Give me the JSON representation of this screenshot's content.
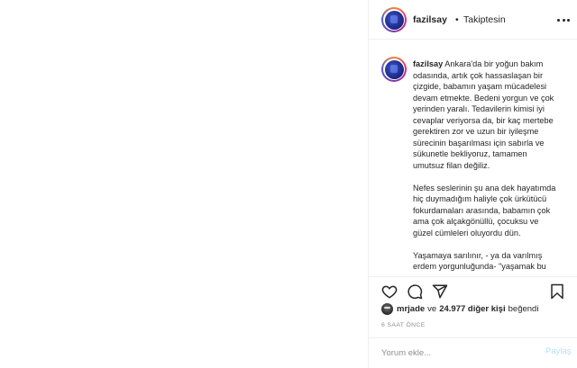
{
  "header": {
    "username": "fazilsay",
    "separator": "•",
    "follow_status": "Takiptesin",
    "more_icon": "more-horizontal-icon"
  },
  "caption": {
    "username": "fazilsay",
    "paragraphs": [
      "Ankara'da bir yoğun bakım\nodasında, artık çok hassaslaşan bir\nçizgide, babamın yaşam mücadelesi\ndevam etmekte. Bedeni yorgun ve çok\nyerinden yaralı. Tedavilerin kimisi iyi\ncevaplar veriyorsa da, bir kaç mertebe\ngerektiren zor ve uzun bir iyileşme\nsürecinin başarılması için sabırla ve\nsükunetle bekliyoruz, tamamen\numutsuz filan değiliz.",
      "Nefes seslerinin şu ana dek hayatımda\nhiç duymadığım haliyle çok ürkütücü\nfokurdamaları arasında, babamın çok\nama çok alçakgönüllü, çocuksu ve\ngüzel cümleleri oluyordu dün.",
      "Yaşamaya sarılınır, - ya da varılmış\nerdem yorgunluğunda- \"yaşamak bu"
    ]
  },
  "actions": {
    "icons": [
      "heart-icon",
      "comment-icon",
      "share-icon",
      "bookmark-icon"
    ]
  },
  "likes": {
    "liker": "mrjade",
    "connector": "ve",
    "count_text": "24.977 diğer kişi",
    "suffix": "beğendi"
  },
  "timestamp": "6 SAAT ÖNCE",
  "comment_box": {
    "placeholder": "Yorum ekle...",
    "post_label": "Paylaş"
  },
  "colors": {
    "text": "#262626",
    "muted": "#8e8e8e",
    "divider": "#efefef",
    "post_button_disabled": "#b2dffc"
  }
}
